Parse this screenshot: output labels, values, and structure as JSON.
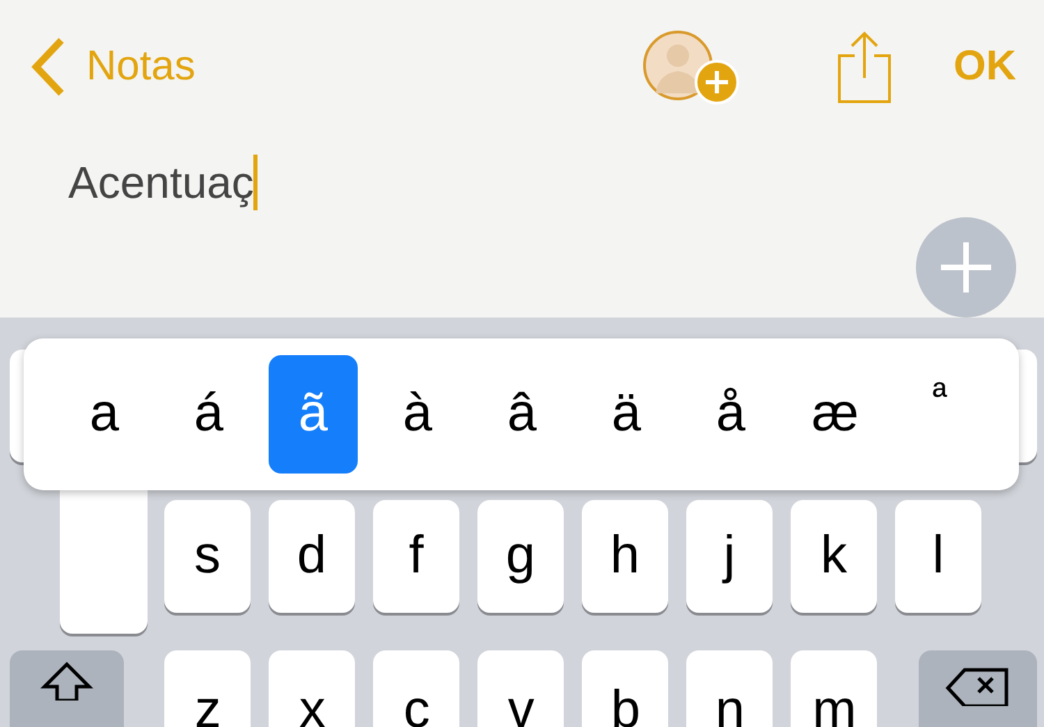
{
  "nav": {
    "back_label": "Notas",
    "done_label": "OK"
  },
  "note": {
    "text": "Acentuaç"
  },
  "accent_popup": {
    "options": [
      {
        "char": "a",
        "selected": false
      },
      {
        "char": "á",
        "selected": false
      },
      {
        "char": "ã",
        "selected": true
      },
      {
        "char": "à",
        "selected": false
      },
      {
        "char": "â",
        "selected": false
      },
      {
        "char": "ä",
        "selected": false
      },
      {
        "char": "å",
        "selected": false
      },
      {
        "char": "æ",
        "selected": false
      },
      {
        "char": "ª",
        "selected": false
      }
    ]
  },
  "keyboard": {
    "middle_row": [
      "s",
      "d",
      "f",
      "g",
      "h",
      "j",
      "k",
      "l"
    ],
    "bottom_row": [
      "z",
      "x",
      "c",
      "v",
      "b",
      "n",
      "m"
    ]
  }
}
